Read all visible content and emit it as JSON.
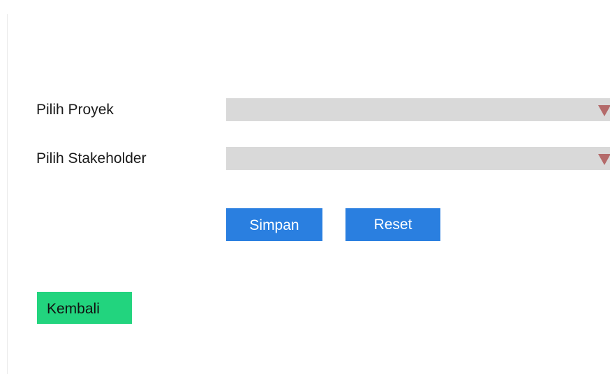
{
  "form": {
    "project_label": "Pilih Proyek",
    "project_value": "",
    "stakeholder_label": "Pilih Stakeholder",
    "stakeholder_value": ""
  },
  "actions": {
    "save_label": "Simpan",
    "reset_label": "Reset",
    "back_label": "Kembali"
  },
  "icons": {
    "dropdown": "chevron-down-icon"
  },
  "colors": {
    "select_bg": "#d9d9d9",
    "caret": "#b46a6a",
    "primary_button": "#2a7fe0",
    "back_button": "#22d47e"
  }
}
